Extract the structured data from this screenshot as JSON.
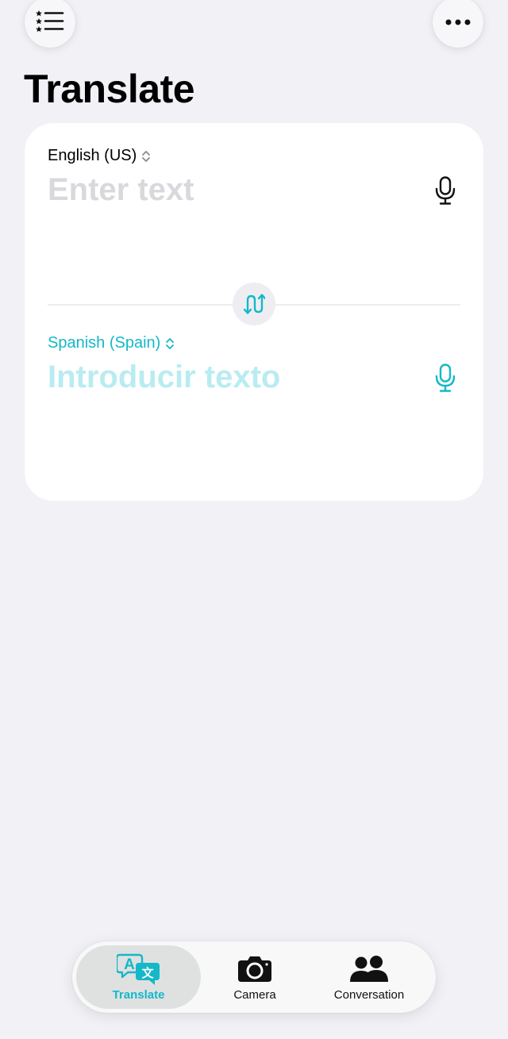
{
  "header": {
    "title": "Translate",
    "favorites_icon": "starred-list-icon",
    "more_icon": "ellipsis-icon"
  },
  "source": {
    "language": "English (US)",
    "placeholder": "Enter text",
    "mic_icon": "microphone-icon"
  },
  "target": {
    "language": "Spanish (Spain)",
    "placeholder": "Introducir texto",
    "mic_icon": "microphone-icon"
  },
  "swap_icon": "swap-languages-icon",
  "tabs": [
    {
      "label": "Translate",
      "icon": "translate-bubbles-icon",
      "selected": true
    },
    {
      "label": "Camera",
      "icon": "camera-icon",
      "selected": false
    },
    {
      "label": "Conversation",
      "icon": "people-icon",
      "selected": false
    }
  ],
  "colors": {
    "accent": "#14b8c8",
    "background": "#f1f1f6",
    "card": "#ffffff"
  }
}
